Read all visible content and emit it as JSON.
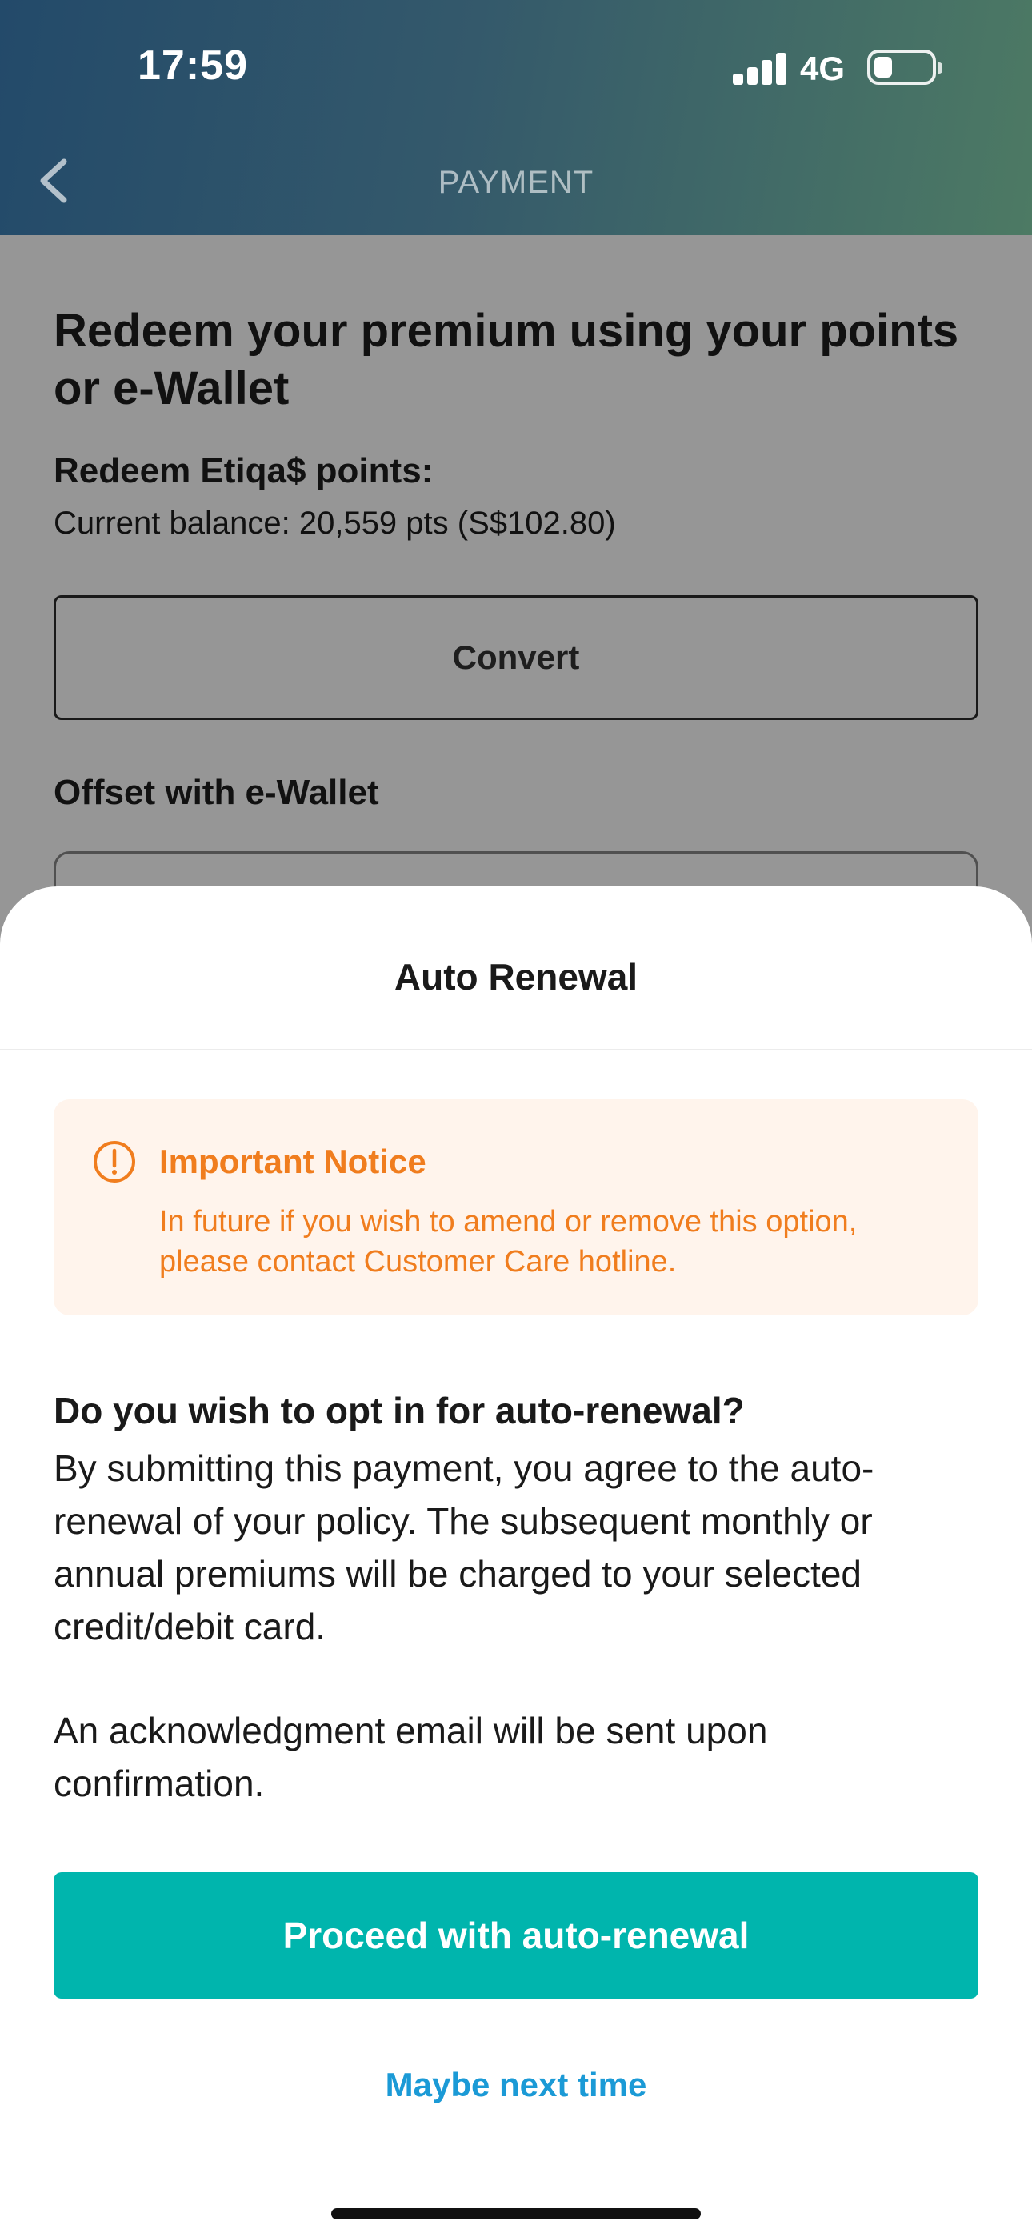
{
  "status_bar": {
    "time": "17:59",
    "network": "4G",
    "signal_bars": 4,
    "battery_level": 0.2
  },
  "header": {
    "title": "PAYMENT",
    "back_icon": "chevron-left-icon"
  },
  "page": {
    "heading": "Redeem your premium using your points or e-Wallet",
    "redeem_label": "Redeem Etiqa$ points:",
    "balance": "Current balance: 20,559 pts (S$102.80)",
    "convert_label": "Convert",
    "ewallet_label": "Offset with e-Wallet"
  },
  "sheet": {
    "title": "Auto Renewal",
    "notice": {
      "icon": "exclamation-circle-icon",
      "title": "Important Notice",
      "text": "In future if you wish to amend or remove this option, please contact Customer Care hotline."
    },
    "question": "Do you wish to opt in for auto-renewal?",
    "body": "By submitting this payment, you agree to the auto-renewal of your policy. The subsequent monthly or annual premiums will be charged to your selected credit/debit card.",
    "acknowledgement": "An acknowledgment email will be sent upon confirmation.",
    "proceed_label": "Proceed with auto-renewal",
    "maybe_label": "Maybe next time"
  },
  "colors": {
    "accent": "#00b5ad",
    "link": "#1b9ad6",
    "notice_text": "#f07d1e",
    "notice_bg": "#fff4ec"
  }
}
